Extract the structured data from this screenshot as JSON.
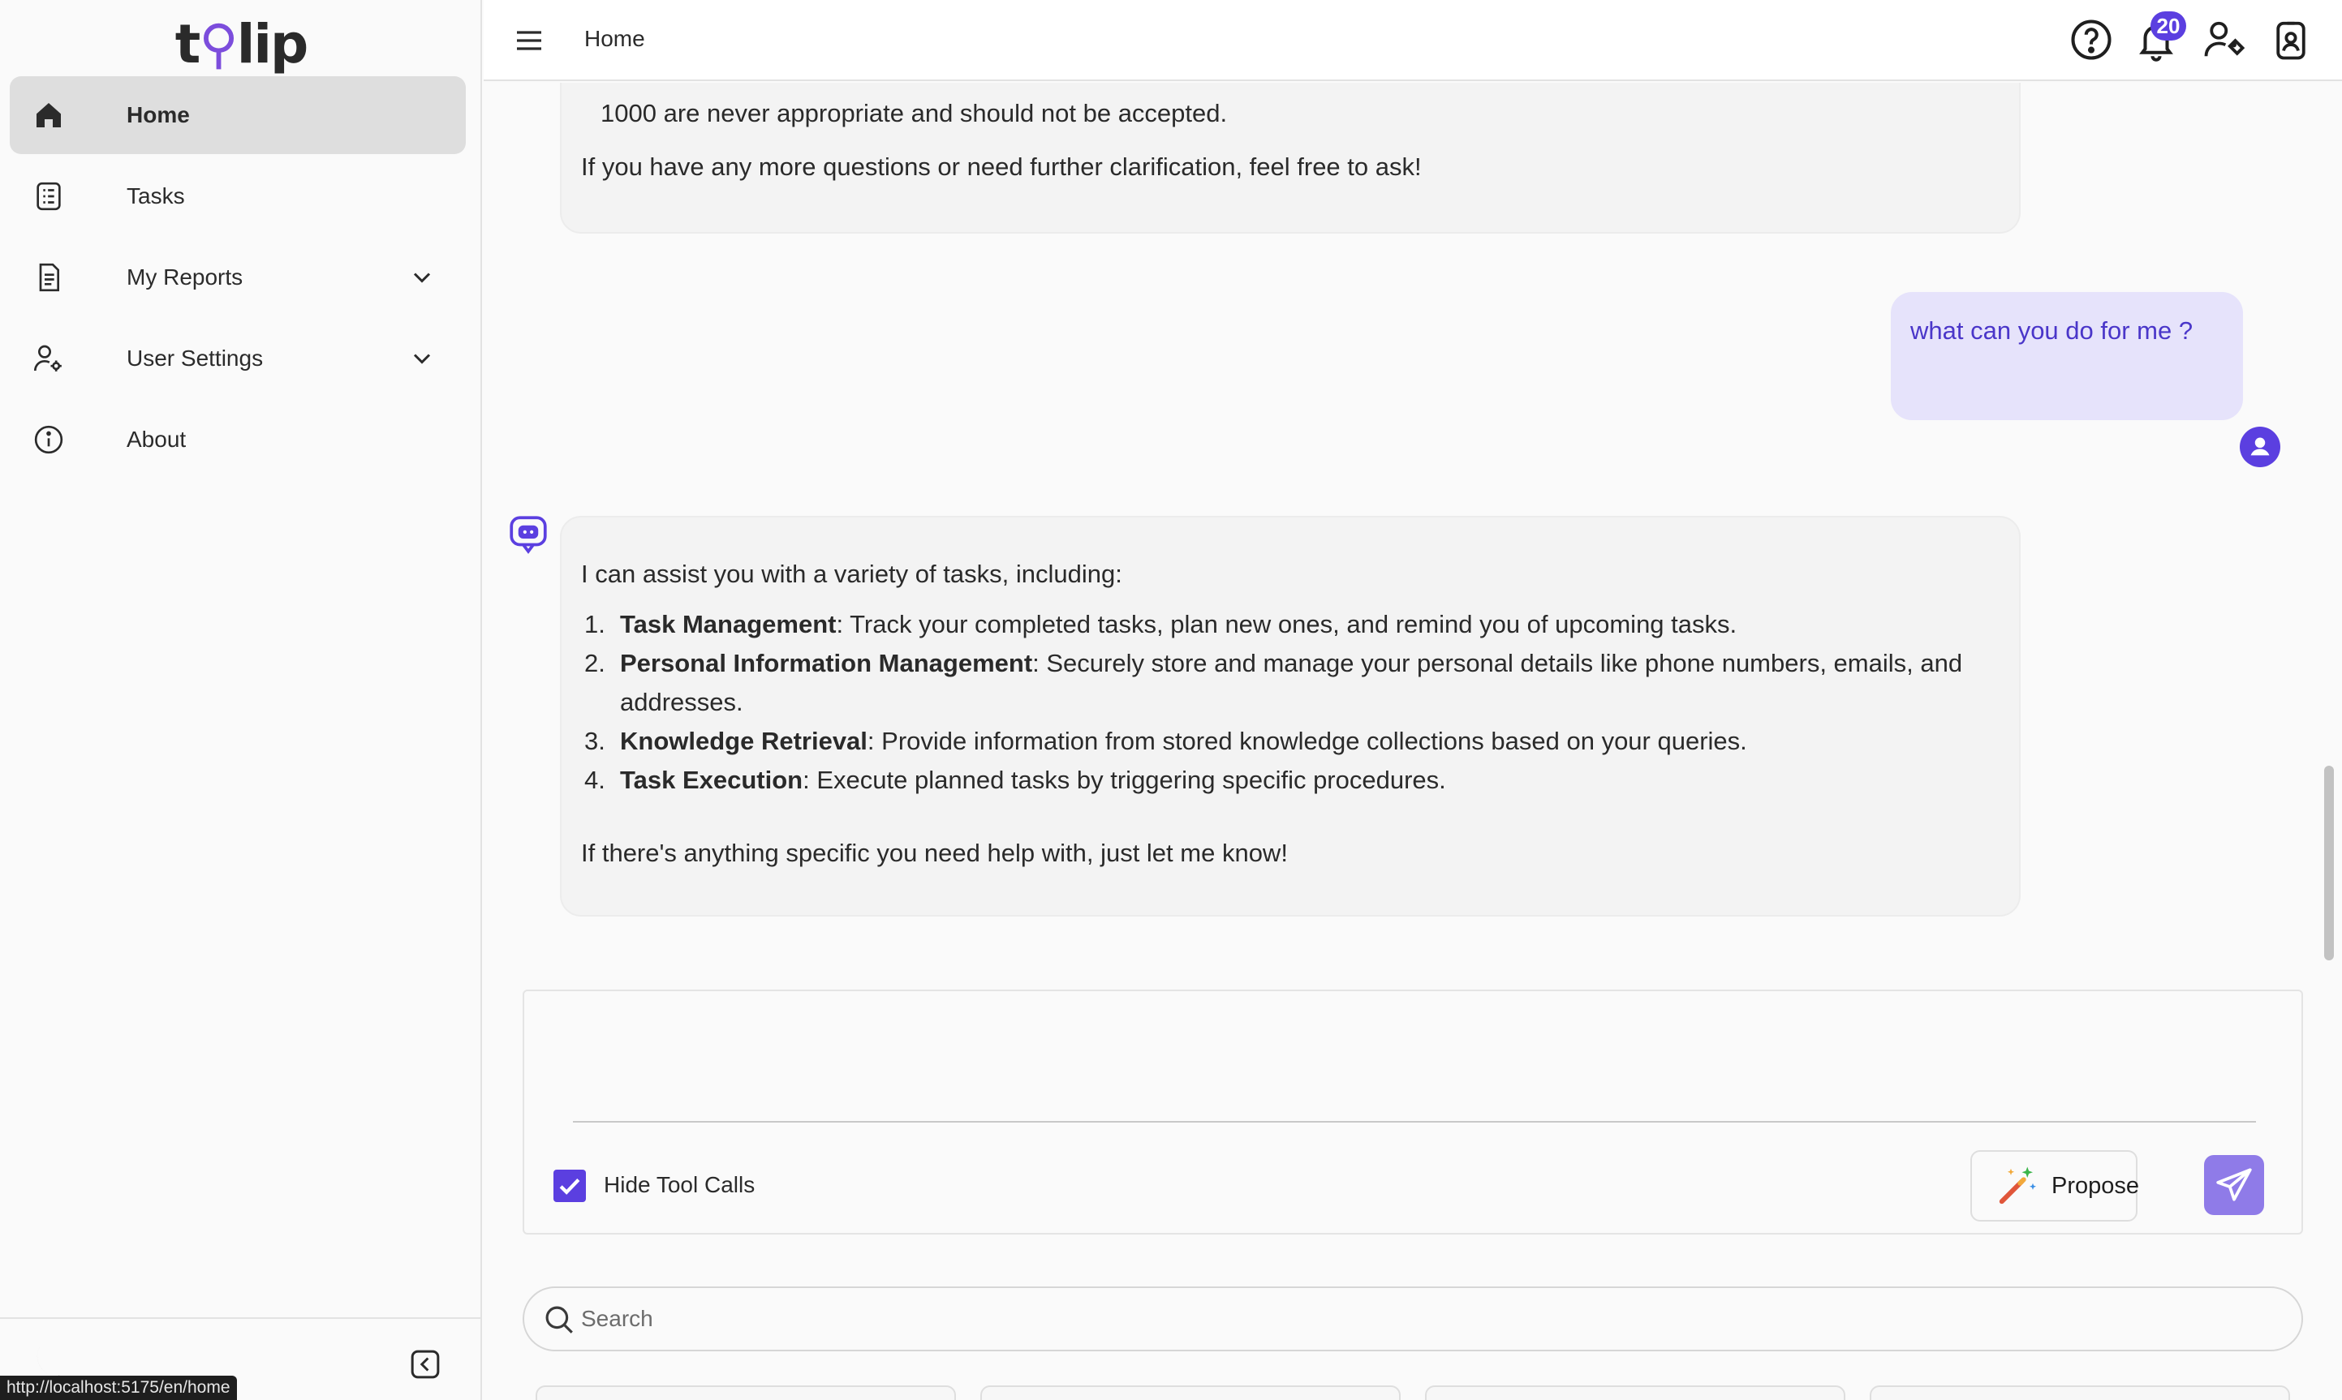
{
  "app": {
    "logo_text_left": "t",
    "logo_text_right": "lip"
  },
  "sidebar": {
    "items": [
      {
        "label": "Home",
        "icon": "home-icon",
        "active": true
      },
      {
        "label": "Tasks",
        "icon": "tasks-icon"
      },
      {
        "label": "My Reports",
        "icon": "report-icon",
        "expandable": true
      },
      {
        "label": "User Settings",
        "icon": "user-settings-icon",
        "expandable": true
      },
      {
        "label": "About",
        "icon": "info-icon"
      }
    ],
    "status_url": "http://localhost:5175/en/home"
  },
  "topbar": {
    "breadcrumb": "Home",
    "notification_count": "20",
    "icons": [
      "help-icon",
      "bell-icon",
      "user-tag-icon",
      "profile-badge-icon"
    ]
  },
  "chat": {
    "messages": [
      {
        "role": "assistant",
        "partial_line": "1000 are never appropriate and should not be accepted.",
        "closing": "If you have any more questions or need further clarification, feel free to ask!"
      },
      {
        "role": "user",
        "text": "what can you do for me ?"
      },
      {
        "role": "assistant",
        "intro": "I can assist you with a variety of tasks, including:",
        "items": [
          {
            "n": "1.",
            "title": "Task Management",
            "text": ": Track your completed tasks, plan new ones, and remind you of upcoming tasks."
          },
          {
            "n": "2.",
            "title": "Personal Information Management",
            "text": ": Securely store and manage your personal details like phone numbers, emails, and addresses."
          },
          {
            "n": "3.",
            "title": "Knowledge Retrieval",
            "text": ": Provide information from stored knowledge collections based on your queries."
          },
          {
            "n": "4.",
            "title": "Task Execution",
            "text": ": Execute planned tasks by triggering specific procedures."
          }
        ],
        "closing": "If there's anything specific you need help with, just let me know!"
      }
    ]
  },
  "composer": {
    "value": "",
    "hide_tool_calls_label": "Hide Tool Calls",
    "hide_tool_calls_checked": true,
    "propose_label": "Propose"
  },
  "search": {
    "placeholder": "Search",
    "value": ""
  },
  "colors": {
    "accent": "#5b3fe0",
    "user_bubble": "#e6e3fb",
    "bot_bubble": "#f3f3f3"
  }
}
